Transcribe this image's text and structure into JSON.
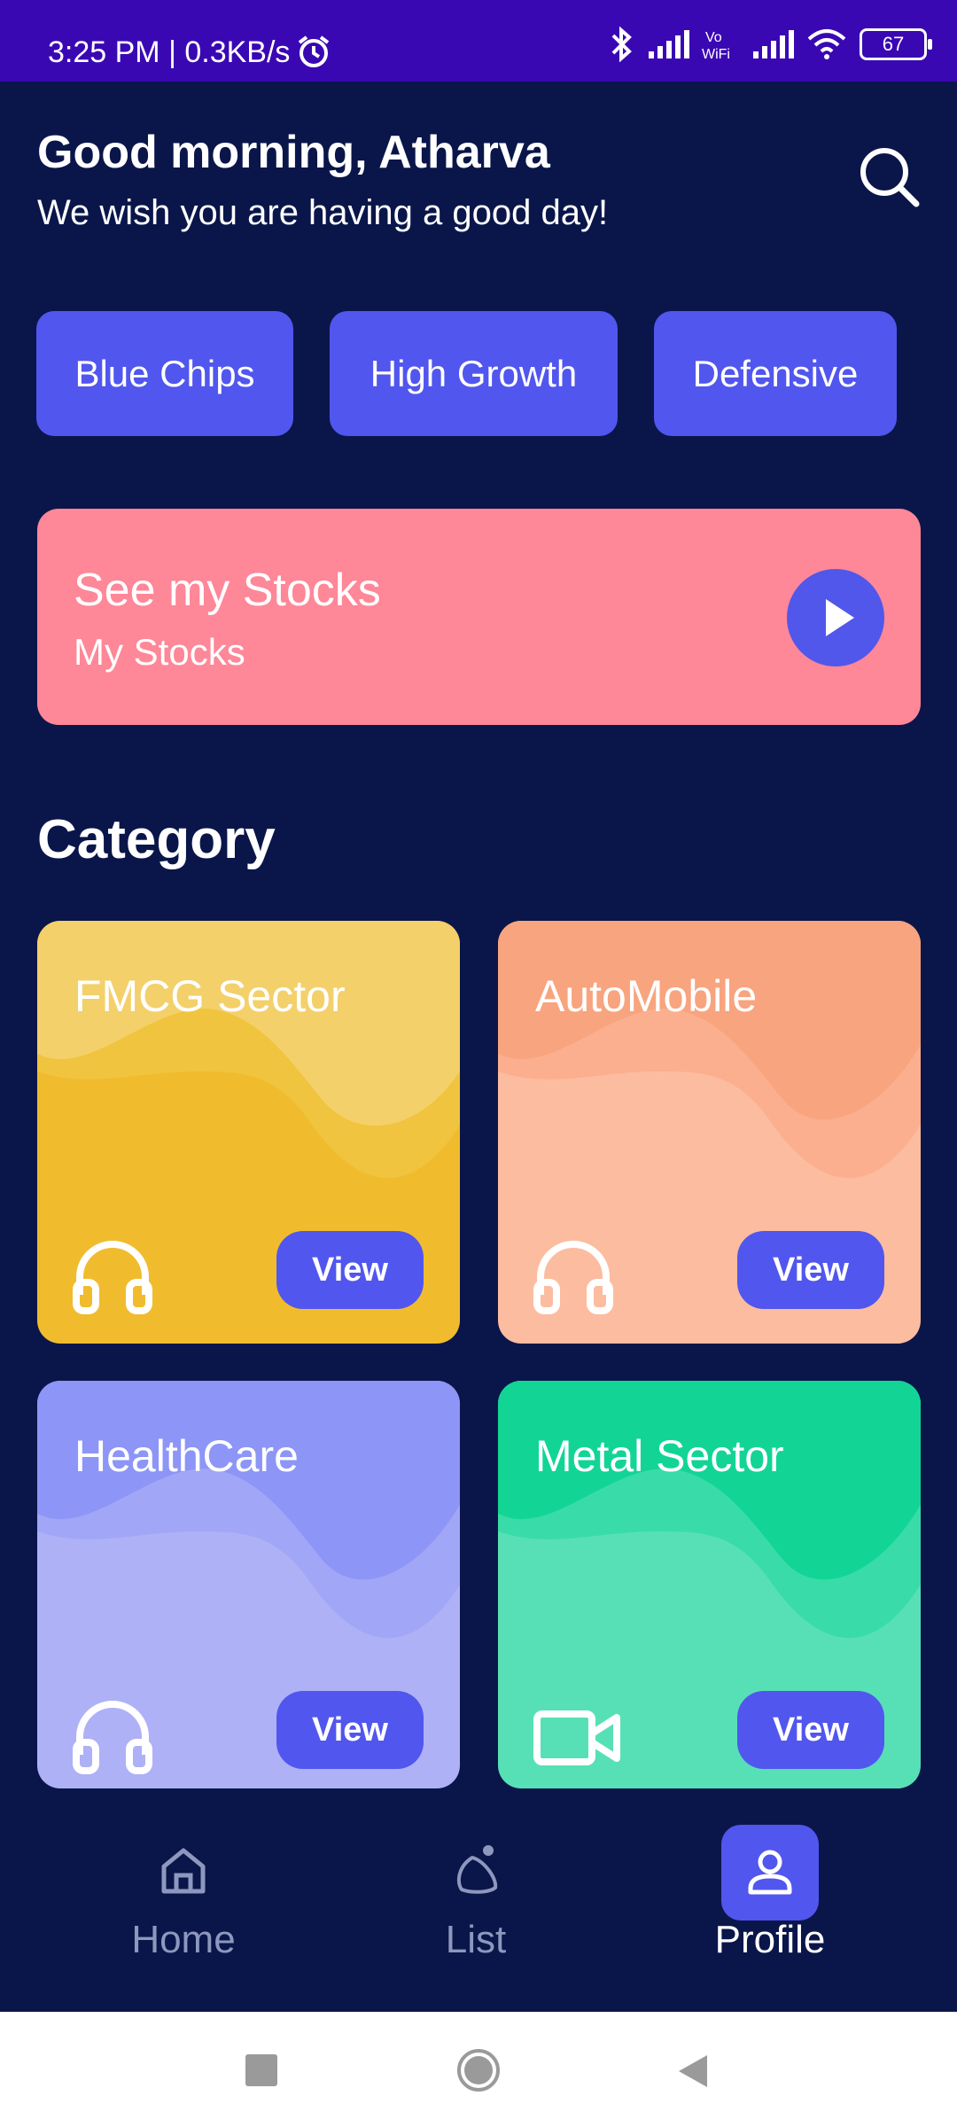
{
  "status_bar": {
    "time": "3:25 PM | 0.3KB/s",
    "battery": "67"
  },
  "header": {
    "greeting": "Good morning, Atharva",
    "subtitle": "We wish you are having a good day!"
  },
  "chips": [
    {
      "label": "Blue Chips"
    },
    {
      "label": "High Growth"
    },
    {
      "label": "Defensive"
    }
  ],
  "banner": {
    "title": "See my Stocks",
    "subtitle": "My Stocks"
  },
  "category": {
    "title": "Category",
    "cards": [
      {
        "title": "FMCG Sector",
        "button": "View",
        "icon": "headphones-icon",
        "color": "#f0bc2e"
      },
      {
        "title": "AutoMobile",
        "button": "View",
        "icon": "headphones-icon",
        "color": "#fcbca0"
      },
      {
        "title": "HealthCare",
        "button": "View",
        "icon": "headphones-icon",
        "color": "#aeb1f6"
      },
      {
        "title": "Metal Sector",
        "button": "View",
        "icon": "video-camera-icon",
        "color": "#57e0b6"
      }
    ]
  },
  "bottom_nav": {
    "items": [
      {
        "label": "Home",
        "icon": "home-icon"
      },
      {
        "label": "List",
        "icon": "list-icon"
      },
      {
        "label": "Profile",
        "icon": "user-icon",
        "active": true
      }
    ]
  },
  "colors": {
    "background": "#0a164a",
    "status_bar": "#3a08b3",
    "accent": "#5156ee",
    "banner": "#fe8798"
  }
}
